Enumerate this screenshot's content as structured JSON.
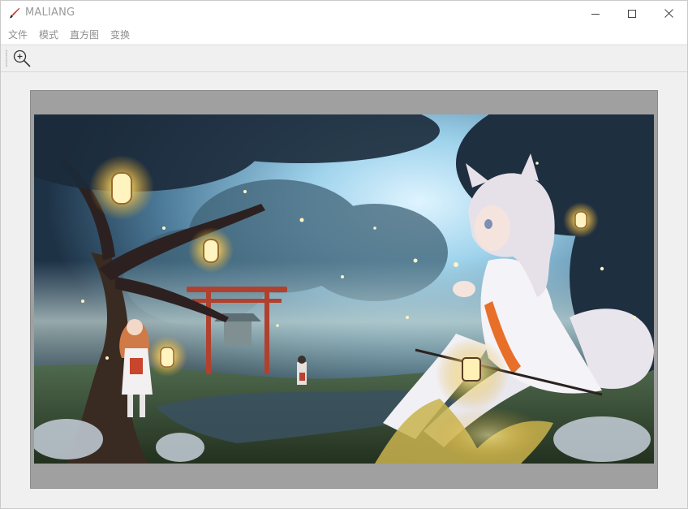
{
  "window": {
    "title": "MALIANG",
    "controls": {
      "minimize_icon": "minimize-icon",
      "maximize_icon": "maximize-icon",
      "close_icon": "close-icon"
    }
  },
  "menubar": {
    "items": [
      {
        "label": "文件"
      },
      {
        "label": "模式"
      },
      {
        "label": "直方图"
      },
      {
        "label": "变换"
      }
    ]
  },
  "toolbar": {
    "zoom_icon": "zoom-in-icon"
  },
  "canvas": {
    "image_subject": "anime-style illustration",
    "frame_color": "#a0a0a0"
  },
  "colors": {
    "accent": "#c0392b",
    "title_text": "#9a9a9a",
    "menu_text": "#8f8f8f"
  }
}
